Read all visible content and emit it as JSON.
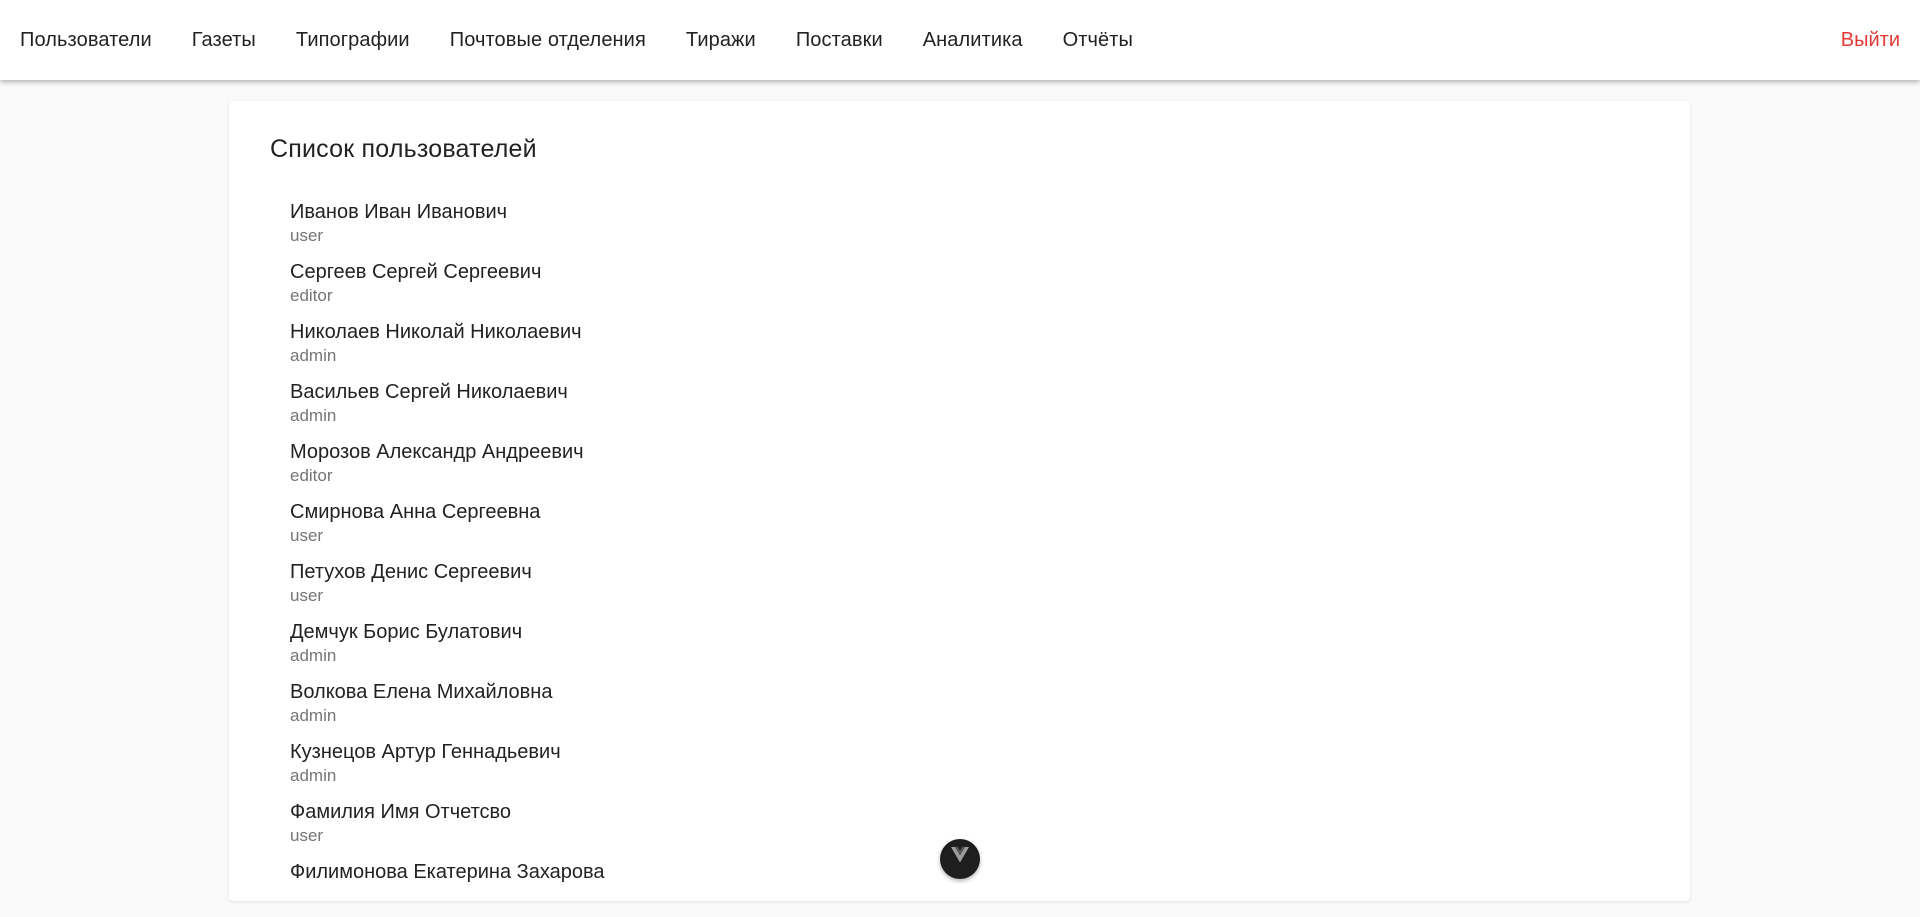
{
  "nav": {
    "items": [
      {
        "label": "Пользователи"
      },
      {
        "label": "Газеты"
      },
      {
        "label": "Типографии"
      },
      {
        "label": "Почтовые отделения"
      },
      {
        "label": "Тиражи"
      },
      {
        "label": "Поставки"
      },
      {
        "label": "Аналитика"
      },
      {
        "label": "Отчёты"
      }
    ],
    "logout_label": "Выйти"
  },
  "users": {
    "title": "Список пользователей",
    "items": [
      {
        "name": "Иванов Иван Иванович",
        "role": "user"
      },
      {
        "name": "Сергеев Сергей Сергеевич",
        "role": "editor"
      },
      {
        "name": "Николаев Николай Николаевич",
        "role": "admin"
      },
      {
        "name": "Васильев Сергей Николаевич",
        "role": "admin"
      },
      {
        "name": "Морозов Александр Андреевич",
        "role": "editor"
      },
      {
        "name": "Смирнова Анна Сергеевна",
        "role": "user"
      },
      {
        "name": "Петухов Денис Сергеевич",
        "role": "user"
      },
      {
        "name": "Демчук Борис Булатович",
        "role": "admin"
      },
      {
        "name": "Волкова Елена Михайловна",
        "role": "admin"
      },
      {
        "name": "Кузнецов Артур Геннадьевич",
        "role": "admin"
      },
      {
        "name": "Фамилия Имя Отчетсво",
        "role": "user"
      },
      {
        "name": "Филимонова Екатерина Захарова",
        "role": ""
      }
    ]
  },
  "colors": {
    "logout": "#e53935",
    "fab_background": "#1e1e1e"
  },
  "icons": {
    "fab_icon": "vue-logo-icon"
  }
}
